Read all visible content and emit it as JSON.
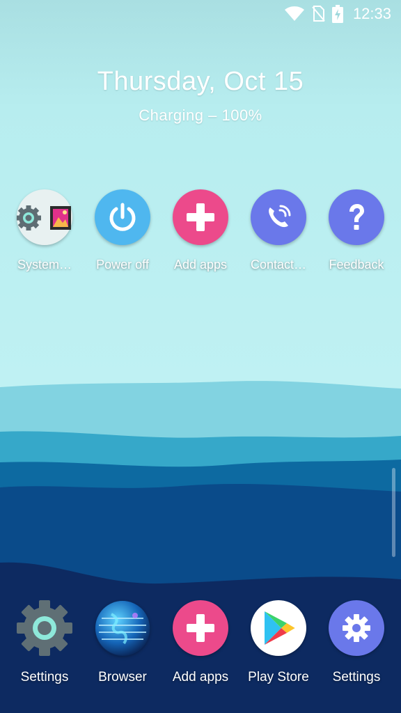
{
  "status_bar": {
    "time": "12:33",
    "icons": [
      "wifi-icon",
      "no-sim-icon",
      "battery-charging-icon"
    ]
  },
  "clock": {
    "date": "Thursday, Oct 15",
    "status": "Charging – 100%"
  },
  "shortcuts": [
    {
      "label": "System…",
      "icon": "system-settings-gallery-icon",
      "color": "#e8f1f1"
    },
    {
      "label": "Power off",
      "icon": "power-icon",
      "color": "#4fb7ef"
    },
    {
      "label": "Add apps",
      "icon": "plus-icon",
      "color": "#ec4a8b"
    },
    {
      "label": "Contact…",
      "icon": "phone-icon",
      "color": "#6a78ea"
    },
    {
      "label": "Feedback",
      "icon": "question-icon",
      "color": "#6a78ea"
    }
  ],
  "dock": [
    {
      "label": "Settings",
      "icon": "gear-icon"
    },
    {
      "label": "Browser",
      "icon": "globe-icon"
    },
    {
      "label": "Add apps",
      "icon": "plus-icon",
      "color": "#ec4a8b"
    },
    {
      "label": "Play Store",
      "icon": "play-store-icon",
      "color": "#ffffff"
    },
    {
      "label": "Settings",
      "icon": "gear-icon",
      "color": "#6a78ea"
    }
  ]
}
